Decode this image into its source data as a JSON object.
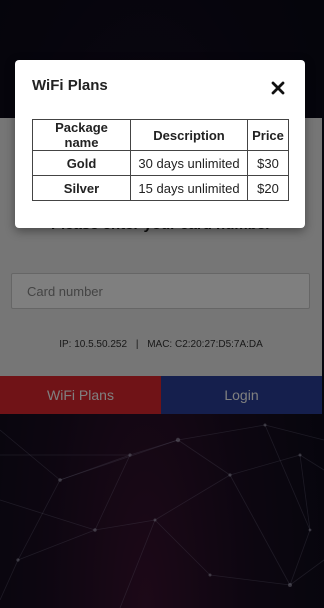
{
  "login": {
    "heading": "Please enter your card number",
    "card_placeholder": "Card number",
    "ip_label": "IP: 10.5.50.252",
    "separator": "|",
    "mac_label": "MAC: C2:20:27:D5:7A:DA",
    "plans_button": "WiFi Plans",
    "login_button": "Login"
  },
  "modal": {
    "title": "WiFi Plans",
    "close_icon": "close-icon",
    "columns": [
      "Package name",
      "Description",
      "Price"
    ],
    "rows": [
      {
        "name": "Gold",
        "description": "30 days unlimited",
        "price": "$30"
      },
      {
        "name": "Silver",
        "description": "15 days unlimited",
        "price": "$20"
      }
    ]
  },
  "colors": {
    "plans_button": "#e0262e",
    "login_button": "#2a3f9a",
    "background": "#0d0b1a"
  }
}
